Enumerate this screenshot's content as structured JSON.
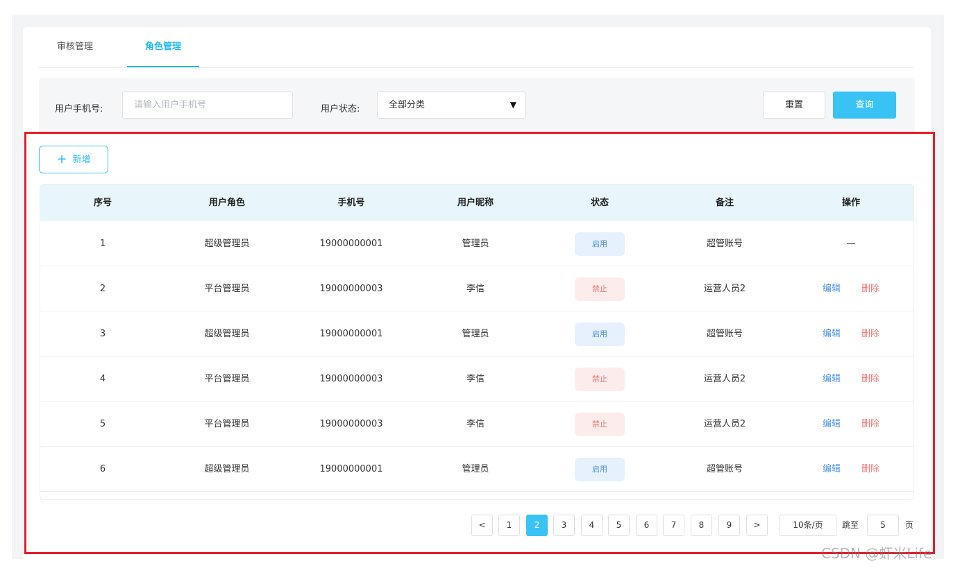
{
  "tabs": [
    {
      "label": "审核管理"
    },
    {
      "label": "角色管理"
    }
  ],
  "filters": {
    "phone_label": "用户手机号:",
    "phone_placeholder": "请输入用户手机号",
    "status_label": "用户状态:",
    "status_value": "全部分类",
    "reset_label": "重置",
    "query_label": "查询"
  },
  "toolbar": {
    "add_icon": "+",
    "add_label": "新增"
  },
  "table": {
    "headers": [
      "序号",
      "用户角色",
      "手机号",
      "用户昵称",
      "状态",
      "备注",
      "操作"
    ],
    "rows": [
      {
        "index": "1",
        "role": "超级管理员",
        "phone": "19000000001",
        "nickname": "管理员",
        "status": "启用",
        "note": "超管账号",
        "action": "—"
      },
      {
        "index": "2",
        "role": "平台管理员",
        "phone": "19000000003",
        "nickname": "李信",
        "status": "禁止",
        "note": "运营人员2",
        "edit": "编辑",
        "delete": "删除"
      },
      {
        "index": "3",
        "role": "超级管理员",
        "phone": "19000000001",
        "nickname": "管理员",
        "status": "启用",
        "note": "超管账号",
        "edit": "编辑",
        "delete": "删除"
      },
      {
        "index": "4",
        "role": "平台管理员",
        "phone": "19000000003",
        "nickname": "李信",
        "status": "禁止",
        "note": "运营人员2",
        "edit": "编辑",
        "delete": "删除"
      },
      {
        "index": "5",
        "role": "平台管理员",
        "phone": "19000000003",
        "nickname": "李信",
        "status": "禁止",
        "note": "运营人员2",
        "edit": "编辑",
        "delete": "删除"
      },
      {
        "index": "6",
        "role": "超级管理员",
        "phone": "19000000001",
        "nickname": "管理员",
        "status": "启用",
        "note": "超管账号",
        "edit": "编辑",
        "delete": "删除"
      }
    ]
  },
  "pagination": {
    "prev": "<",
    "pages": [
      "1",
      "2",
      "3",
      "4",
      "5",
      "6",
      "7",
      "8",
      "9"
    ],
    "current": "2",
    "next": ">",
    "page_size": "10条/页",
    "jump_label": "跳至",
    "jump_value": "5",
    "page_unit": "页"
  },
  "watermark": "CSDN @虾米Life",
  "colors": {
    "accent": "#39c3f5",
    "enabled_text": "#4a8fe6",
    "disabled_text": "#f07a7a",
    "highlight_border": "#e41d2a"
  }
}
